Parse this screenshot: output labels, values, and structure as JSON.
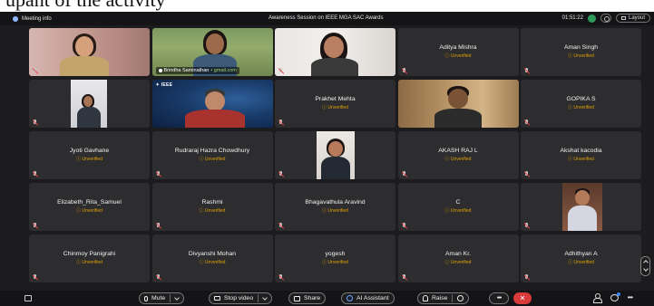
{
  "caption": "upant of the activity",
  "topbar": {
    "meeting_info": "Meeting info",
    "title": "Awareness Session on IEEE MGA SAC Awards",
    "timer": "01:51:22",
    "layout": "Layout",
    "recording_color": "#2e9a5a"
  },
  "status_label": "ⓘ Unverified",
  "tiles": [
    {
      "kind": "video",
      "name": ""
    },
    {
      "kind": "video",
      "name": "Brindha Saminathan",
      "email": "• gmail.com"
    },
    {
      "kind": "video",
      "name": ""
    },
    {
      "kind": "name",
      "name": "Aditya Mishra"
    },
    {
      "kind": "name",
      "name": "Aman Singh"
    },
    {
      "kind": "video",
      "name": ""
    },
    {
      "kind": "video",
      "name": "",
      "badge": "✦ IEEE"
    },
    {
      "kind": "name",
      "name": "Prakhet Mehta"
    },
    {
      "kind": "video",
      "name": ""
    },
    {
      "kind": "name",
      "name": "GOPIKA S"
    },
    {
      "kind": "name",
      "name": "Jyoti Gavhane"
    },
    {
      "kind": "name",
      "name": "Rudraraj Hazra Chowdhury"
    },
    {
      "kind": "video",
      "name": ""
    },
    {
      "kind": "name",
      "name": "AKASH RAJ L"
    },
    {
      "kind": "name",
      "name": "Akshat kacodia"
    },
    {
      "kind": "name",
      "name": "Elizabeth_Rita_Samuel"
    },
    {
      "kind": "name",
      "name": "Rashmi"
    },
    {
      "kind": "name",
      "name": "Bhagavathula Aravind"
    },
    {
      "kind": "name",
      "name": "C"
    },
    {
      "kind": "video",
      "name": ""
    },
    {
      "kind": "name",
      "name": "Chinmoy Panigrahi"
    },
    {
      "kind": "name",
      "name": "Divyanshi Mohan"
    },
    {
      "kind": "name",
      "name": "yogesh"
    },
    {
      "kind": "name",
      "name": "Aman Kr."
    },
    {
      "kind": "name",
      "name": "Adhithyan A"
    }
  ],
  "toolbar": {
    "mute": "Mute",
    "stop_video": "Stop video",
    "share": "Share",
    "ai_assistant": "AI Assistant",
    "raise": "Raise",
    "leave": "✕",
    "leave_color": "#d93a3a",
    "accent": "#3b82f6"
  }
}
